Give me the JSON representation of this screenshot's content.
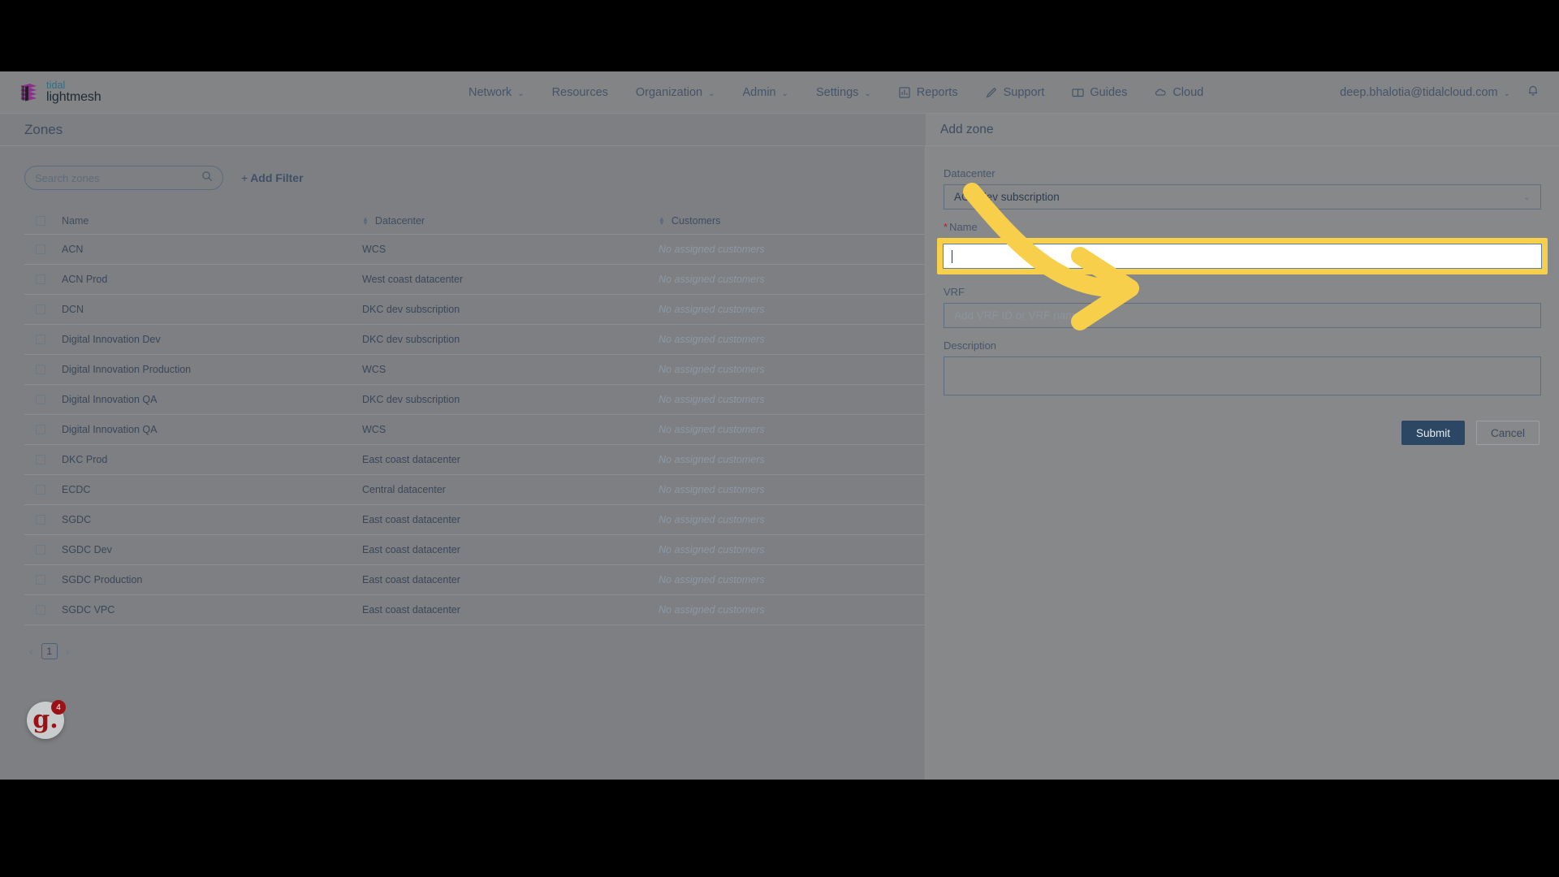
{
  "brand": {
    "top": "tidal",
    "bottom": "lightmesh",
    "logo_color": "#8e2f8e",
    "accent": "#2f6f86"
  },
  "nav": {
    "items": [
      {
        "label": "Network",
        "caret": true,
        "icon": ""
      },
      {
        "label": "Resources",
        "caret": false,
        "icon": ""
      },
      {
        "label": "Organization",
        "caret": true,
        "icon": ""
      },
      {
        "label": "Admin",
        "caret": true,
        "icon": ""
      },
      {
        "label": "Settings",
        "caret": true,
        "icon": ""
      },
      {
        "label": "Reports",
        "caret": false,
        "icon": "bar-chart-icon"
      },
      {
        "label": "Support",
        "caret": false,
        "icon": "pen-icon"
      },
      {
        "label": "Guides",
        "caret": false,
        "icon": "book-icon"
      },
      {
        "label": "Cloud",
        "caret": false,
        "icon": "cloud-icon"
      }
    ],
    "user_email": "deep.bhalotia@tidalcloud.com",
    "user_caret": "⌄",
    "notification_icon": "bell-icon"
  },
  "page": {
    "title": "Zones"
  },
  "toolbar": {
    "search_placeholder": "Search zones",
    "search_value": "",
    "search_icon": "search-icon",
    "add_filter_label": "Add Filter",
    "add_filter_plus": "+"
  },
  "table": {
    "columns": [
      "Name",
      "Datacenter",
      "Customers"
    ],
    "rows": [
      {
        "name": "ACN",
        "datacenter": "WCS",
        "customers": "No assigned customers"
      },
      {
        "name": "ACN Prod",
        "datacenter": "West coast datacenter",
        "customers": "No assigned customers"
      },
      {
        "name": "DCN",
        "datacenter": "DKC dev subscription",
        "customers": "No assigned customers"
      },
      {
        "name": "Digital Innovation Dev",
        "datacenter": "DKC dev subscription",
        "customers": "No assigned customers"
      },
      {
        "name": "Digital Innovation Production",
        "datacenter": "WCS",
        "customers": "No assigned customers"
      },
      {
        "name": "Digital Innovation QA",
        "datacenter": "DKC dev subscription",
        "customers": "No assigned customers"
      },
      {
        "name": "Digital Innovation QA",
        "datacenter": "WCS",
        "customers": "No assigned customers"
      },
      {
        "name": "DKC Prod",
        "datacenter": "East coast datacenter",
        "customers": "No assigned customers"
      },
      {
        "name": "ECDC",
        "datacenter": "Central datacenter",
        "customers": "No assigned customers"
      },
      {
        "name": "SGDC",
        "datacenter": "East coast datacenter",
        "customers": "No assigned customers"
      },
      {
        "name": "SGDC Dev",
        "datacenter": "East coast datacenter",
        "customers": "No assigned customers"
      },
      {
        "name": "SGDC Production",
        "datacenter": "East coast datacenter",
        "customers": "No assigned customers"
      },
      {
        "name": "SGDC VPC",
        "datacenter": "East coast datacenter",
        "customers": "No assigned customers"
      }
    ]
  },
  "pagination": {
    "prev": "‹",
    "page": "1",
    "next": "›"
  },
  "help_widget": {
    "glyph": "g.",
    "badge": "4",
    "color": "#9a1215"
  },
  "drawer": {
    "title": "Add zone",
    "datacenter_label": "Datacenter",
    "datacenter_value": "ACN dev subscription",
    "name_label": "Name",
    "name_required_marker": "*",
    "name_value": "",
    "vrf_label": "VRF",
    "vrf_placeholder": "Add VRF ID or VRF name",
    "vrf_value": "",
    "description_label": "Description",
    "description_value": "",
    "submit_label": "Submit",
    "cancel_label": "Cancel",
    "highlight_color": "#f7cf4a"
  }
}
